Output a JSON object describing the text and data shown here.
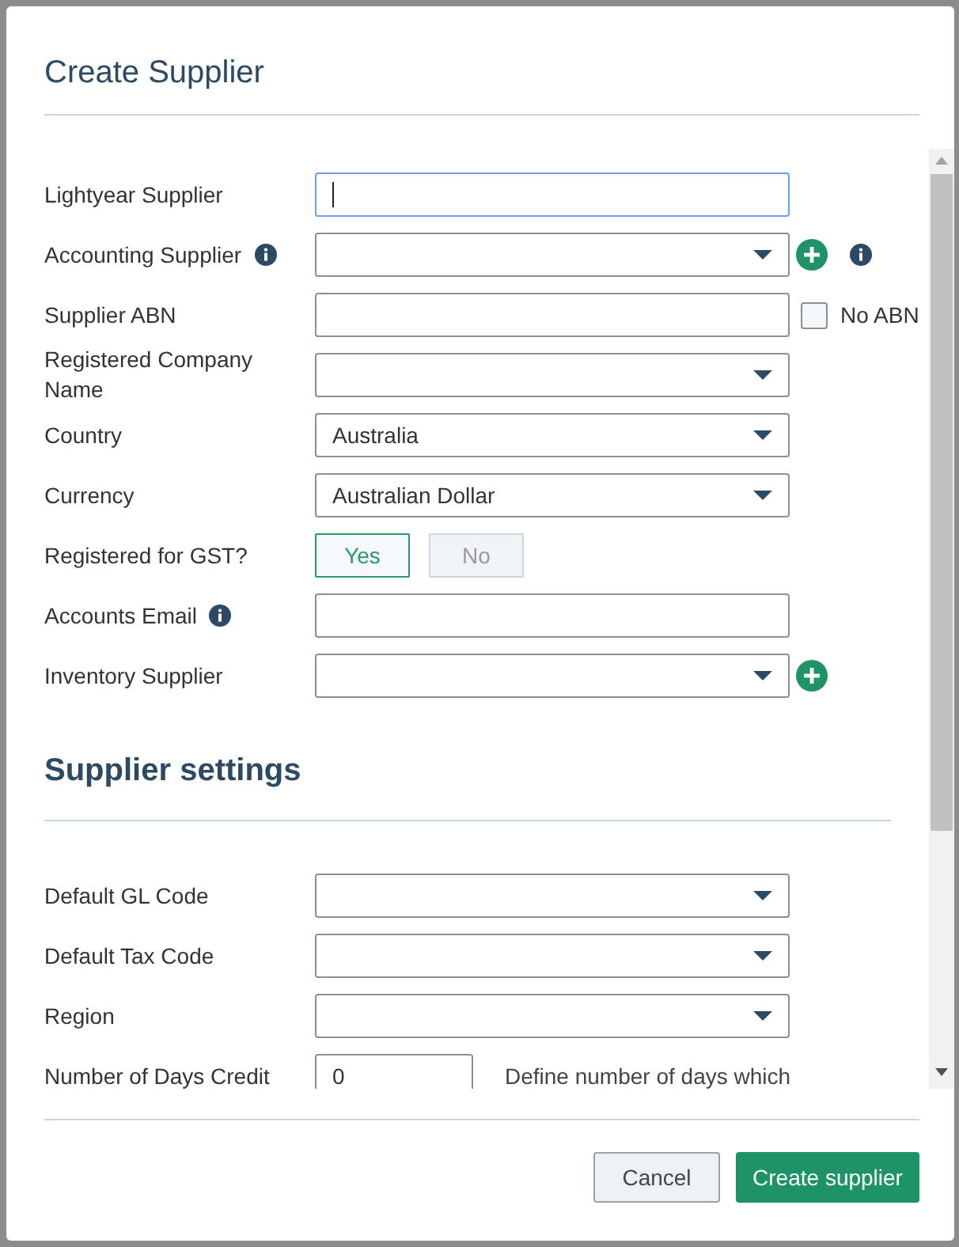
{
  "dialog": {
    "title": "Create Supplier"
  },
  "fields": [
    {
      "kind": "text",
      "label": "Lightyear Supplier",
      "focused": true
    },
    {
      "kind": "select",
      "label": "Accounting Supplier",
      "info": true,
      "add": true,
      "trailing_info": true
    },
    {
      "kind": "text",
      "label": "Supplier ABN",
      "checkbox": {
        "label": "No ABN",
        "checked": false
      }
    },
    {
      "kind": "select",
      "label": "Registered Company Name"
    },
    {
      "kind": "select",
      "label": "Country",
      "value": "Australia"
    },
    {
      "kind": "select",
      "label": "Currency",
      "value": "Australian Dollar"
    },
    {
      "kind": "toggle",
      "label": "Registered for GST?",
      "options": [
        {
          "label": "Yes",
          "selected": true
        },
        {
          "label": "No",
          "selected": false
        }
      ]
    },
    {
      "kind": "text",
      "label": "Accounts Email",
      "info": true
    },
    {
      "kind": "select",
      "label": "Inventory Supplier",
      "add": true
    }
  ],
  "settings": {
    "title": "Supplier settings",
    "fields": [
      {
        "kind": "select",
        "label": "Default GL Code"
      },
      {
        "kind": "select",
        "label": "Default Tax Code"
      },
      {
        "kind": "select",
        "label": "Region"
      },
      {
        "kind": "number",
        "label": "Number of Days Credit",
        "value": "0",
        "help": "Define number of days which"
      }
    ]
  },
  "buttons": [
    {
      "label": "Cancel",
      "kind": "secondary"
    },
    {
      "label": "Create supplier",
      "kind": "primary"
    }
  ]
}
